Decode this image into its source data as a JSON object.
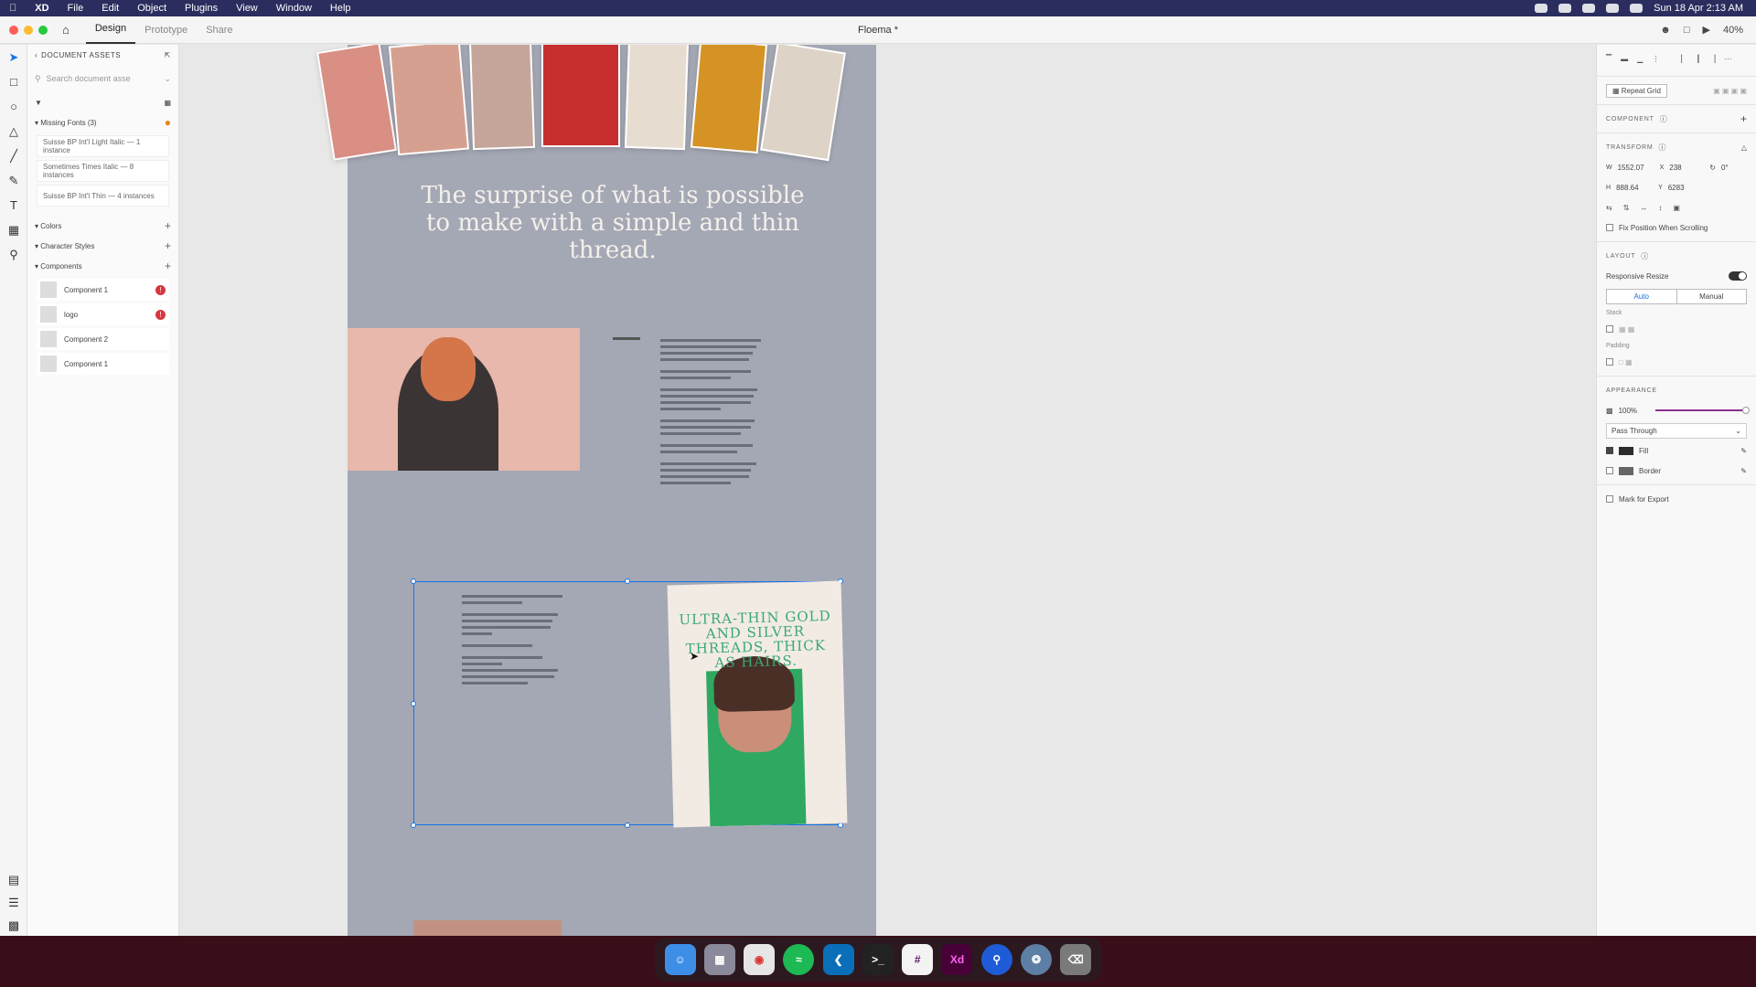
{
  "menubar": {
    "app": "XD",
    "items": [
      "File",
      "Edit",
      "Object",
      "Plugins",
      "View",
      "Window",
      "Help"
    ],
    "clock": "Sun 18 Apr  2:13 AM"
  },
  "window": {
    "title": "Floema *",
    "tabs": [
      "Design",
      "Prototype",
      "Share"
    ],
    "zoom": "40%"
  },
  "assets": {
    "header": "DOCUMENT ASSETS",
    "search_placeholder": "Search document asse",
    "missing_fonts_label": "Missing Fonts (3)",
    "missing_fonts": [
      "Suisse BP Int'l Light Italic — 1 instance",
      "Sometimes Times Italic — 8 instances",
      "Suisse BP Int'l Thin — 4 instances"
    ],
    "colors_label": "Colors",
    "char_styles_label": "Character Styles",
    "components_label": "Components",
    "components": [
      {
        "name": "Component 1",
        "warn": true
      },
      {
        "name": "logo",
        "warn": true
      },
      {
        "name": "Component 2",
        "warn": false
      },
      {
        "name": "Component 1",
        "warn": false
      }
    ]
  },
  "canvas": {
    "headline": "The surprise of what is possible to make with a simple and thin thread.",
    "poster_text": "ULTRA-THIN GOLD AND SILVER THREADS, THICK AS HAIRS."
  },
  "props": {
    "repeat_grid": "Repeat Grid",
    "component_label": "COMPONENT",
    "transform_label": "TRANSFORM",
    "w": "1552.07",
    "x": "238",
    "rotation": "0°",
    "h": "888.64",
    "y": "6283",
    "fix_position": "Fix Position When Scrolling",
    "layout_label": "LAYOUT",
    "responsive_resize": "Responsive Resize",
    "auto": "Auto",
    "manual": "Manual",
    "stack": "Stack",
    "padding": "Padding",
    "appearance_label": "APPEARANCE",
    "opacity": "100%",
    "blend": "Pass Through",
    "fill": "Fill",
    "border": "Border",
    "mark_export": "Mark for Export"
  },
  "dock": [
    "Finder",
    "Launchpad",
    "Chrome",
    "Spotify",
    "VS Code",
    "Terminal",
    "Slack",
    "Xd",
    "Maps",
    "Safari",
    "Trash"
  ]
}
